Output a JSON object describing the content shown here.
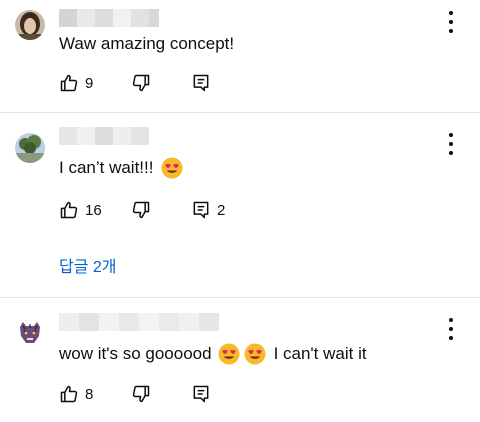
{
  "comments": [
    {
      "text": "Waw amazing concept!",
      "likes": "9",
      "replies_count": "",
      "avatar_icon": "profile-photo-woman",
      "emoji_icon": ""
    },
    {
      "text": "I can’t wait!!!",
      "likes": "16",
      "replies_count": "2",
      "avatar_icon": "profile-photo-tree",
      "emoji_icon": "heart-eyes-emoji",
      "replies_link": "답글 2개"
    },
    {
      "text_before": "wow it's so goooood",
      "text_after": "I can't wait it",
      "likes": "8",
      "replies_count": "",
      "avatar_icon": "profile-photo-tiger",
      "emoji_icon": "heart-eyes-emoji"
    }
  ],
  "icons": {
    "more": "more-vertical-icon",
    "like": "thumbs-up-icon",
    "dislike": "thumbs-down-icon",
    "reply": "reply-icon"
  },
  "colors": {
    "link": "#065fd4",
    "divider": "#e5e5e5",
    "text": "#0f0f0f"
  }
}
